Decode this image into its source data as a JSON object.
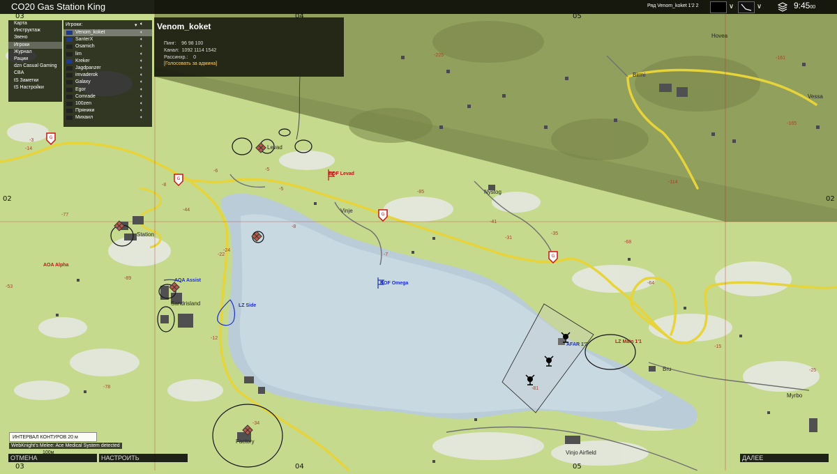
{
  "window": {
    "title": "CO20 Gas Station King",
    "player_rank": "Ряд Venom_koket 1'2 2",
    "clock_main": "9:45",
    "clock_seconds": "00"
  },
  "menu": {
    "items": [
      {
        "label": "Карта"
      },
      {
        "label": "Инструктаж"
      },
      {
        "label": "Звено"
      },
      {
        "label": "Игроки",
        "selected": true
      },
      {
        "label": "Журнал"
      },
      {
        "label": "Рации"
      },
      {
        "label": "dzn Casual Gaming"
      },
      {
        "label": "CBA"
      },
      {
        "label": "tS Заметки"
      },
      {
        "label": "tS Настройки"
      }
    ]
  },
  "players_panel": {
    "header": "Игроки:",
    "items": [
      {
        "name": "Venom_koket",
        "color": "#1f3a8a",
        "selected": true
      },
      {
        "name": "SanterX",
        "color": "#1f3a8a"
      },
      {
        "name": "Osamich",
        "color": "#222222"
      },
      {
        "name": "lim",
        "color": "#222222"
      },
      {
        "name": "Kreker",
        "color": "#1f3a8a"
      },
      {
        "name": "Jagdpanzer",
        "color": "#222222"
      },
      {
        "name": "imvaderok",
        "color": "#222222"
      },
      {
        "name": "Galaxy",
        "color": "#222222"
      },
      {
        "name": "Egor",
        "color": "#222222"
      },
      {
        "name": "Comrade",
        "color": "#222222"
      },
      {
        "name": "100zen",
        "color": "#222222"
      },
      {
        "name": "Пряники",
        "color": "#222222"
      },
      {
        "name": "Михаил",
        "color": "#222222"
      }
    ]
  },
  "player_info": {
    "name": "Venom_koket",
    "ping_label": "Пинг:",
    "ping_values": "96   98   100",
    "channel_label": "Канал:",
    "channel_values": "1092  1114  1542",
    "rassinhr_label": "Рассинхр.:",
    "rassinhr_value": "0",
    "vote_admin": "[Голосовать за админа]"
  },
  "map": {
    "grid_labels": {
      "top_03": "03",
      "top_04": "04",
      "top_05": "05",
      "bottom_03": "03",
      "bottom_04": "04",
      "bottom_05": "05",
      "left_02": "02",
      "right_02": "02"
    },
    "place_names": {
      "levad": "Levad",
      "vinje": "Vinje",
      "nystog": "Nystog",
      "birmi": "Birmi",
      "hovea": "Hovea",
      "vessa": "Vessa",
      "myrbo": "Myrbo",
      "bru": "Bru",
      "factory": "Factory",
      "vinjo_airfield": "Vinjo Airfield",
      "sandrisland": "Sandrisland",
      "station": "Station"
    },
    "markers": {
      "bof_levad": "BOF Levad",
      "bof_omega": "BOF Omega",
      "aoa_alpha": "AOA Alpha",
      "aoa_assist": "AOA Assist",
      "lz_side": "LZ Side",
      "lz_main": "LZ Main 1'1",
      "afar": "AFAR 1'2"
    },
    "elevations": [
      "-3",
      "-14",
      "-8",
      "-77",
      "-44",
      "-53",
      "-89",
      "-78",
      "-24",
      "-22",
      "-12",
      "-6",
      "-5",
      "-7",
      "-85",
      "-35",
      "-68",
      "-64",
      "-31",
      "-225",
      "-161",
      "-114",
      "-165",
      "-34",
      "-81",
      "-15",
      "-25",
      "-41",
      "-8",
      "-5"
    ]
  },
  "bottom": {
    "contour_interval": "ИНТЕРВАЛ КОНТУРОВ 20 м",
    "notification": "WebKnight's Melee: Ace Medical System detected",
    "scale_label": "100м",
    "cancel": "ОТМЕНА",
    "configure": "НАСТРОИТЬ",
    "next": "ДАЛЕЕ"
  }
}
